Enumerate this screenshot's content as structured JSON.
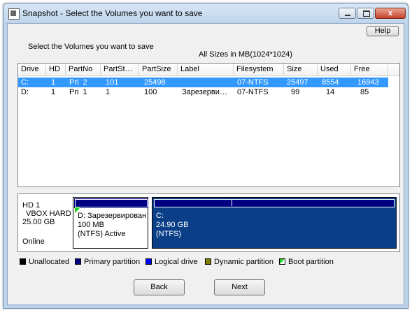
{
  "window": {
    "title": "Snapshot - Select the Volumes you want to save",
    "close_glyph": "x"
  },
  "help_label": "Help",
  "intro_text": "Select the Volumes you want to save",
  "sizes_note": "All Sizes in MB(1024*1024)",
  "columns": [
    "Drive",
    "HD",
    "PartNo",
    "PartSt…",
    "PartSize",
    "Label",
    "Filesystem",
    "Size",
    "Used",
    "Free"
  ],
  "rows": [
    {
      "drive": "C:",
      "hd": "1",
      "partno": "Pri  2",
      "partstart": "101",
      "partsize": "25498",
      "label": "",
      "filesystem": "07-NTFS",
      "size": "25497",
      "used": "8554",
      "free": "16943",
      "selected": true
    },
    {
      "drive": "D:",
      "hd": "1",
      "partno": "Pri  1",
      "partstart": "1",
      "partsize": "100",
      "label": "Зарезерви…",
      "filesystem": "07-NTFS",
      "size": "99",
      "used": "14",
      "free": "85",
      "selected": false
    }
  ],
  "disk": {
    "name": "HD 1",
    "model": "VBOX HARD",
    "capacity": "25.00 GB",
    "status": "Online",
    "partitions": [
      {
        "line1": "D: Зарезервирован",
        "line2": "100 MB",
        "line3": "(NTFS) Active",
        "usage_fraction": 0.14
      },
      {
        "line1": "C:",
        "line2": "24.90 GB",
        "line3": "(NTFS)",
        "usage_fraction": 0.34
      }
    ]
  },
  "legend": [
    {
      "label": "Unallocated",
      "color": "#000000"
    },
    {
      "label": "Primary partition",
      "color": "#000080"
    },
    {
      "label": "Logical drive",
      "color": "#0000ff"
    },
    {
      "label": "Dynamic partition",
      "color": "#808000"
    },
    {
      "label": "Boot partition",
      "color": "#19d219"
    }
  ],
  "buttons": {
    "back": "Back",
    "next": "Next"
  }
}
